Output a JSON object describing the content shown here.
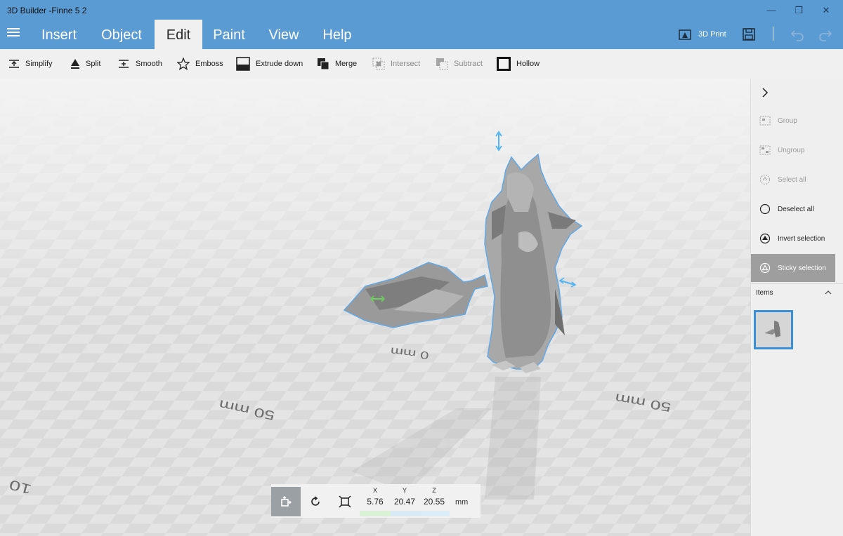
{
  "window": {
    "title": "3D Builder -Finne 5 2",
    "minimize": "—",
    "maximize": "❐",
    "close": "✕"
  },
  "menu": {
    "tabs": [
      "Insert",
      "Object",
      "Edit",
      "Paint",
      "View",
      "Help"
    ],
    "active_tab": "Edit",
    "print_label": "3D Print"
  },
  "toolbar": {
    "simplify": "Simplify",
    "split": "Split",
    "smooth": "Smooth",
    "emboss": "Emboss",
    "extrude_down": "Extrude down",
    "merge": "Merge",
    "intersect": "Intersect",
    "subtract": "Subtract",
    "hollow": "Hollow"
  },
  "sidepanel": {
    "group": "Group",
    "ungroup": "Ungroup",
    "select_all": "Select all",
    "deselect_all": "Deselect all",
    "invert_selection": "Invert selection",
    "sticky_selection": "Sticky selection",
    "items_label": "Items"
  },
  "viewport": {
    "axis_labels": [
      "0 mm",
      "50 mm",
      "50 mm",
      "10"
    ]
  },
  "transform": {
    "x_label": "X",
    "y_label": "Y",
    "z_label": "Z",
    "x_value": "5.76",
    "y_value": "20.47",
    "z_value": "20.55",
    "unit": "mm"
  },
  "colors": {
    "accent": "#5b9bd3",
    "selection_outline": "#62a8e5",
    "x_axis": "#6bd35c",
    "y_axis": "#52b4f0"
  }
}
